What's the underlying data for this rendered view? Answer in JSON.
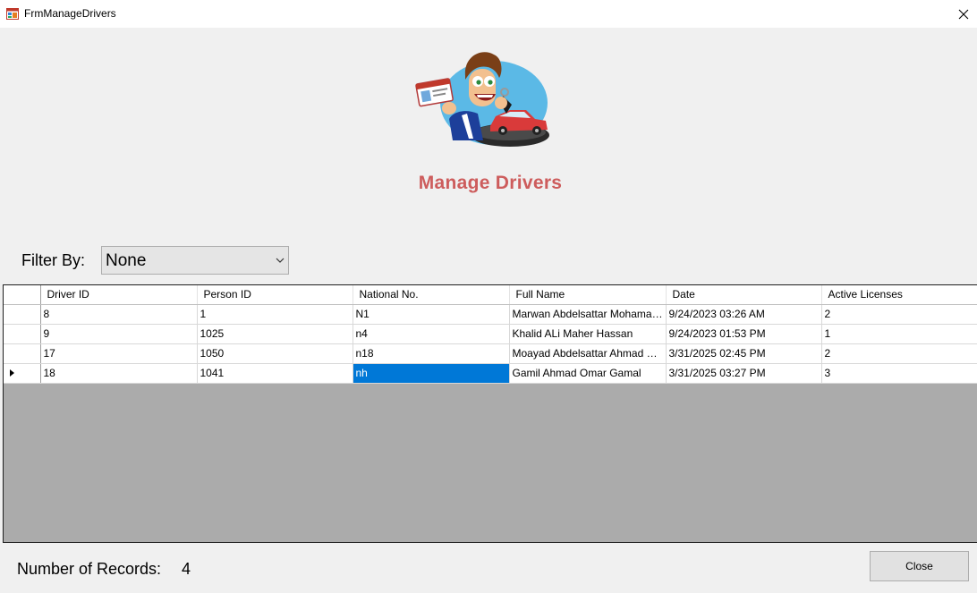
{
  "window": {
    "title": "FrmManageDrivers"
  },
  "header": {
    "heading": "Manage Drivers"
  },
  "filter": {
    "label": "Filter By:",
    "selected": "None"
  },
  "grid": {
    "columns": [
      "Driver ID",
      "Person ID",
      "National No.",
      "Full Name",
      "Date",
      "Active Licenses"
    ],
    "rows": [
      [
        "8",
        "1",
        "N1",
        "Marwan Abdelsattar Mohamad A...",
        "9/24/2023 03:26 AM",
        "2"
      ],
      [
        "9",
        "1025",
        "n4",
        "Khalid ALi Maher Hassan",
        "9/24/2023 01:53 PM",
        "1"
      ],
      [
        "17",
        "1050",
        "n18",
        "Moayad Abdelsattar Ahmad Mar...",
        "3/31/2025 02:45 PM",
        "2"
      ],
      [
        "18",
        "1041",
        "nh",
        "Gamil Ahmad Omar Gamal",
        "3/31/2025 03:27 PM",
        "3"
      ]
    ]
  },
  "footer": {
    "records_label": "Number of Records:",
    "records_count": "4",
    "close_label": "Close"
  },
  "colors": {
    "heading": "#cd5c5c",
    "selection": "#0078d7",
    "grid_background": "#ababab"
  }
}
